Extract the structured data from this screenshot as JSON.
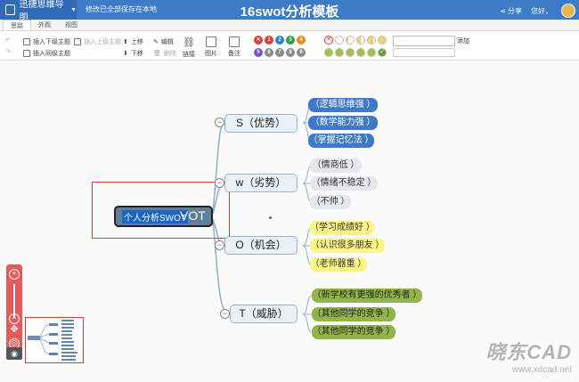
{
  "app": {
    "name": "迅捷思维导图",
    "saved_status": "修改已全部保存在本地",
    "doc_title": "16swot分析模板",
    "share": "分享",
    "greeting": "您好，"
  },
  "tabs": [
    "思路",
    "外观",
    "视图"
  ],
  "toolbar": {
    "insert_child": "插入下级主题",
    "insert_parent": "插入上级主题",
    "insert_sibling": "插入同级主题",
    "move_up": "上移",
    "move_down": "下移",
    "edit": "编辑",
    "delete": "删除",
    "link": "链接",
    "image": "图片",
    "note": "备注",
    "add": "添加",
    "priority_numbers": [
      "1",
      "2",
      "3",
      "4",
      "5",
      "6",
      "7",
      "8",
      "9"
    ],
    "priority_colors": [
      "#e03b3b",
      "#e03b3b",
      "#2b7fd0",
      "#2aa14a",
      "#f08a1a",
      "#7a54c6",
      "#8a8a8a",
      "#8a8a8a",
      "#8a8a8a"
    ]
  },
  "mindmap": {
    "root": {
      "selected_text": "个人分析SWOT",
      "trailing_text": "VOT"
    },
    "branches": [
      {
        "label": "S（优势）",
        "color": "blue",
        "leaves": [
          "（逻辑思维强 ）",
          "（数学能力强 ）",
          "（掌握记忆法 ）"
        ]
      },
      {
        "label": "w（劣势）",
        "color": "gray",
        "leaves": [
          "（情商低 ）",
          "（情绪不稳定 ）",
          "（不帅 ）"
        ]
      },
      {
        "label": "O（机会）",
        "color": "yellow",
        "leaves": [
          "（学习成绩好 ）",
          "（认识很多朋友 ）",
          "（老师器重 ）"
        ]
      },
      {
        "label": "T（威胁）",
        "color": "green",
        "leaves": [
          "（新学校有更强的优秀者 ）",
          "（其他同学的竞争 ）",
          "（其他同学的竞争 ）"
        ]
      }
    ]
  },
  "watermark": {
    "brand": "晓东CAD",
    "url": "www.xdcad.net"
  }
}
